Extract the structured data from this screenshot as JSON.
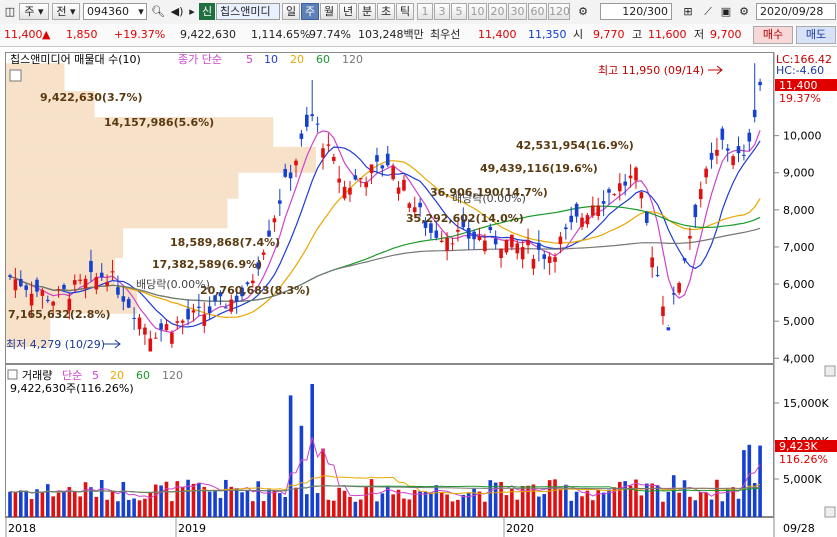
{
  "toolbar": {
    "market": "주",
    "period_type": "전",
    "code": "094360",
    "credit_badge": "신",
    "stock_name": "칩스앤미디",
    "period_tabs": [
      "일",
      "주",
      "월",
      "년",
      "분",
      "초",
      "틱"
    ],
    "selected_period": "주",
    "minute_tabs": [
      "1",
      "3",
      "5",
      "10",
      "20",
      "30",
      "60",
      "120"
    ],
    "count": "120/300",
    "date": "2020/09/28"
  },
  "quote": {
    "price": "11,400",
    "arrow": "▲",
    "change": "1,850",
    "change_pct": "+19.37%",
    "volume": "9,422,630",
    "volume_ratio": "1,114.65%",
    "exec_strength": "97.74%",
    "amount": "103,248백만",
    "best_ask_label": "최우선",
    "best_ask": "11,400",
    "best_bid": "11,350",
    "open_label": "시",
    "open": "9,770",
    "high_label": "고",
    "high": "11,600",
    "low_label": "저",
    "low": "9,700",
    "buy_label": "매수",
    "sell_label": "매도"
  },
  "price_panel": {
    "title": "칩스앤미디어 매물대 수(10)",
    "ma_label": "종가 단순",
    "ma_periods": [
      "5",
      "10",
      "20",
      "60",
      "120"
    ],
    "ma_colors": [
      "#cc44cc",
      "#1e3cd6",
      "#e8a800",
      "#1a9a2a",
      "#777777"
    ],
    "lc_label": "LC:166.42",
    "hc_label": "HC:-4.60",
    "current_price": "11,400",
    "current_pct": "19.37%",
    "high_annotation": "최고 11,950 (09/14)",
    "low_annotation": "최저 4,279 (10/29)",
    "dividend_labels": [
      "배당락(0.00%)",
      "배당락(0.00%)"
    ]
  },
  "volume_panel": {
    "title": "거래량",
    "ma_label": "단순",
    "ma_periods": [
      "5",
      "20",
      "60",
      "120"
    ],
    "latest": "9,422,630주(116.26%)",
    "current": "9,423K",
    "current_pct": "116.26%"
  },
  "x_axis": {
    "labels": [
      "2018",
      "2019",
      "2020"
    ],
    "end_label": "09/28"
  },
  "chart_data": {
    "type": "candlestick",
    "title": "칩스앤미디어 매물대 수(10)",
    "y_ticks": [
      4000,
      5000,
      6000,
      7000,
      8000,
      9000,
      10000
    ],
    "y_range": [
      3900,
      12200
    ],
    "vol_ticks": [
      "5,000K",
      "10,000K",
      "15,000K"
    ],
    "vol_range": [
      0,
      17500
    ],
    "volume_profile": [
      {
        "label": "7,165,632(2.8%)",
        "price_low": 4300,
        "price_high": 5200,
        "share": 2.8
      },
      {
        "label": "20,760,683(8.3%)",
        "price_low": 5200,
        "price_high": 5900,
        "share": 8.3
      },
      {
        "label": "17,382,589(6.9%)",
        "price_low": 5900,
        "price_high": 6700,
        "share": 6.9
      },
      {
        "label": "18,589,868(7.4%)",
        "price_low": 6700,
        "price_high": 7500,
        "share": 7.4
      },
      {
        "label": "35,292,602(14.0%)",
        "price_low": 7500,
        "price_high": 8300,
        "share": 14.0
      },
      {
        "label": "36,906,190(14.7%)",
        "price_low": 8300,
        "price_high": 9000,
        "share": 14.7
      },
      {
        "label": "49,439,116(19.6%)",
        "price_low": 9000,
        "price_high": 9700,
        "share": 19.6
      },
      {
        "label": "42,531,954(16.9%)",
        "price_low": 9700,
        "price_high": 10500,
        "share": 16.9
      },
      {
        "label": "14,157,986(5.6%)",
        "price_low": 10500,
        "price_high": 11200,
        "share": 5.6
      },
      {
        "label": "9,422,630(3.7%)",
        "price_low": 11200,
        "price_high": 11950,
        "share": 3.7
      }
    ]
  }
}
